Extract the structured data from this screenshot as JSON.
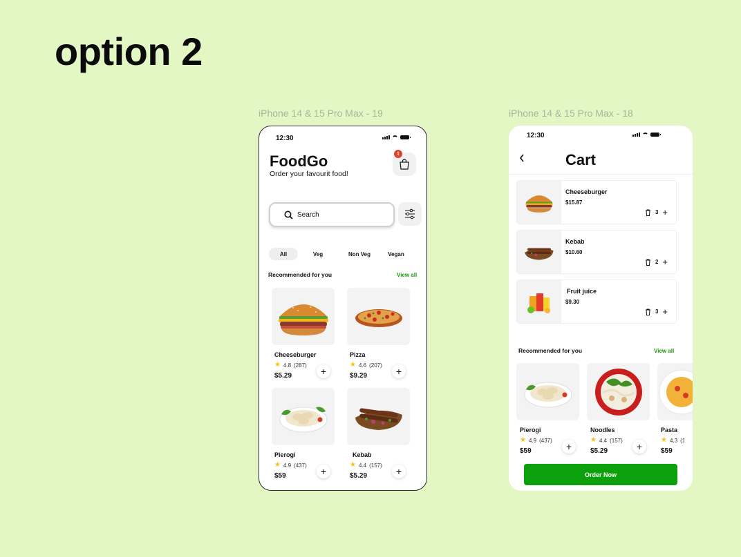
{
  "page": {
    "title": "option 2",
    "background": "#e3f7c5",
    "accent": "#0da00d"
  },
  "frames": {
    "home_label": "iPhone 14 & 15 Pro Max - 19",
    "cart_label": "iPhone 14 & 15 Pro Max - 18"
  },
  "home": {
    "status_time": "12:30",
    "brand": "FoodGo",
    "tagline": "Order your favourit food!",
    "cart_badge": "1",
    "cart_icon": "shopping-bag-icon",
    "search_placeholder": "Search",
    "search_icon": "search-icon",
    "filter_icon": "sliders-icon",
    "chips": [
      "All",
      "Veg",
      "Non Veg",
      "Vegan"
    ],
    "active_chip": "All",
    "section_title": "Recommended for you",
    "view_all": "View all",
    "products": [
      {
        "name": "Cheeseburger",
        "rating": "4.8",
        "reviews": "(287)",
        "price": "$5.29",
        "image": "burger"
      },
      {
        "name": "Pizza",
        "rating": "4.6",
        "reviews": "(207)",
        "price": "$9.29",
        "image": "pizza"
      },
      {
        "name": "Pierogi",
        "rating": "4.9",
        "reviews": "(437)",
        "price": "$59",
        "image": "pierogi"
      },
      {
        "name": "Kebab",
        "rating": "4.4",
        "reviews": "(157)",
        "price": "$5.29",
        "image": "kebab"
      }
    ]
  },
  "cart": {
    "status_time": "12:30",
    "title": "Cart",
    "back_icon": "chevron-left-icon",
    "items": [
      {
        "name": "Cheeseburger",
        "price": "$15.87",
        "qty": "3",
        "image": "burger"
      },
      {
        "name": "Kebab",
        "price": "$10.60",
        "qty": "2",
        "image": "kebab"
      },
      {
        "name": "Fruit juice",
        "price": "$9.30",
        "qty": "3",
        "image": "juice"
      }
    ],
    "section_title": "Recommended for you",
    "view_all": "View all",
    "recommended": [
      {
        "name": "Pierogi",
        "rating": "4.9",
        "reviews": "(437)",
        "price": "$59",
        "image": "pierogi"
      },
      {
        "name": "Noodles",
        "rating": "4.4",
        "reviews": "(157)",
        "price": "$5.29",
        "image": "noodles"
      },
      {
        "name": "Pasta",
        "rating": "4.3",
        "reviews": "(1",
        "price": "$59",
        "image": "pasta"
      }
    ],
    "order_button": "Order Now"
  }
}
